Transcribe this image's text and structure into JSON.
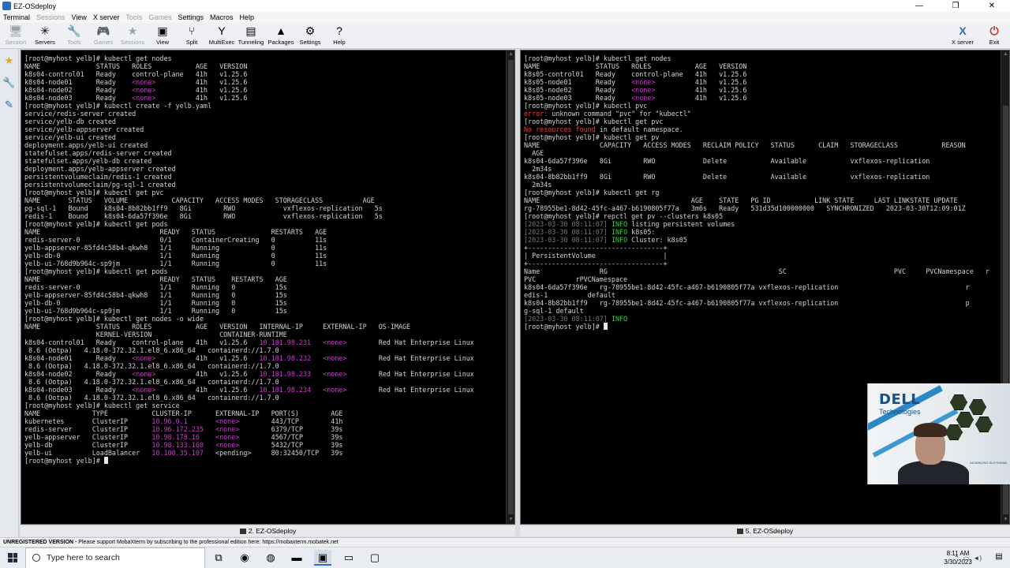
{
  "window": {
    "title": "EZ-OSdeploy",
    "controls": [
      "—",
      "❐",
      "✕"
    ]
  },
  "menu": [
    {
      "label": "Terminal",
      "enabled": true
    },
    {
      "label": "Sessions",
      "enabled": false
    },
    {
      "label": "View",
      "enabled": true
    },
    {
      "label": "X server",
      "enabled": true
    },
    {
      "label": "Tools",
      "enabled": false
    },
    {
      "label": "Games",
      "enabled": false
    },
    {
      "label": "Settings",
      "enabled": true
    },
    {
      "label": "Macros",
      "enabled": true
    },
    {
      "label": "Help",
      "enabled": true
    }
  ],
  "toolbar": {
    "items": [
      {
        "label": "Session",
        "icon": "session-icon",
        "glyph": "🖥",
        "enabled": false
      },
      {
        "label": "Servers",
        "icon": "servers-icon",
        "glyph": "✳",
        "enabled": true
      },
      {
        "label": "Tools",
        "icon": "tools-icon",
        "glyph": "🔧",
        "enabled": false
      },
      {
        "label": "Games",
        "icon": "games-icon",
        "glyph": "🎮",
        "enabled": false
      },
      {
        "label": "Sessions",
        "icon": "sessions-star-icon",
        "glyph": "★",
        "enabled": false
      },
      {
        "label": "View",
        "icon": "view-icon",
        "glyph": "▣",
        "enabled": true
      },
      {
        "label": "Split",
        "icon": "split-icon",
        "glyph": "⑂",
        "enabled": true
      },
      {
        "label": "MultiExec",
        "icon": "multiexec-icon",
        "glyph": "Y",
        "enabled": true
      },
      {
        "label": "Tunneling",
        "icon": "tunneling-icon",
        "glyph": "▤",
        "enabled": true
      },
      {
        "label": "Packages",
        "icon": "packages-icon",
        "glyph": "▲",
        "enabled": true
      },
      {
        "label": "Settings",
        "icon": "settings-gear-icon",
        "glyph": "⚙",
        "enabled": true
      },
      {
        "label": "Help",
        "icon": "help-icon",
        "glyph": "?",
        "enabled": true
      }
    ],
    "right": [
      {
        "label": "X server",
        "icon": "xserver-icon",
        "glyph": "X"
      },
      {
        "label": "Exit",
        "icon": "power-icon",
        "glyph": "⏻"
      }
    ]
  },
  "left_terminal": {
    "tab_label": "2. EZ-OSdeploy",
    "lines": [
      [
        {
          "t": "[root@myhost yelb]# kubectl get nodes"
        }
      ],
      [
        {
          "t": "NAME              STATUS   ROLES           AGE   VERSION"
        }
      ],
      [
        {
          "t": "k8s04-control01   Ready    control-plane   41h   v1.25.6"
        }
      ],
      [
        {
          "t": "k8s04-node01      Ready    "
        },
        {
          "t": "<none>",
          "c": "mag"
        },
        {
          "t": "          41h   v1.25.6"
        }
      ],
      [
        {
          "t": "k8s04-node02      Ready    "
        },
        {
          "t": "<none>",
          "c": "mag"
        },
        {
          "t": "          41h   v1.25.6"
        }
      ],
      [
        {
          "t": "k8s04-node03      Ready    "
        },
        {
          "t": "<none>",
          "c": "mag"
        },
        {
          "t": "          41h   v1.25.6"
        }
      ],
      [
        {
          "t": "[root@myhost yelb]# kubectl create -f yelb.yaml"
        }
      ],
      [
        {
          "t": "service/redis-server created"
        }
      ],
      [
        {
          "t": "service/yelb-db created"
        }
      ],
      [
        {
          "t": "service/yelb-appserver created"
        }
      ],
      [
        {
          "t": "service/yelb-ui created"
        }
      ],
      [
        {
          "t": "deployment.apps/yelb-ui created"
        }
      ],
      [
        {
          "t": "statefulset.apps/redis-server created"
        }
      ],
      [
        {
          "t": "statefulset.apps/yelb-db created"
        }
      ],
      [
        {
          "t": "deployment.apps/yelb-appserver created"
        }
      ],
      [
        {
          "t": "persistentvolumeclaim/redis-1 created"
        }
      ],
      [
        {
          "t": "persistentvolumeclaim/pg-sql-1 created"
        }
      ],
      [
        {
          "t": "[root@myhost yelb]# kubectl get pvc"
        }
      ],
      [
        {
          "t": "NAME       STATUS   VOLUME           CAPACITY   ACCESS MODES   STORAGECLASS          AGE"
        }
      ],
      [
        {
          "t": "pg-sql-1   Bound    k8s04-8b82bb1ff9   8Gi        RWO            vxflexos-replication   5s"
        }
      ],
      [
        {
          "t": "redis-1    Bound    k8s04-6da57f396e   8Gi        RWO            vxflexos-replication   5s"
        }
      ],
      [
        {
          "t": "[root@myhost yelb]# kubectl get pods"
        }
      ],
      [
        {
          "t": "NAME                              READY   STATUS              RESTARTS   AGE"
        }
      ],
      [
        {
          "t": "redis-server-0                    0/1     ContainerCreating   0          11s"
        }
      ],
      [
        {
          "t": "yelb-appserver-85fd4c58b4-qkwh8   1/1     Running             0          11s"
        }
      ],
      [
        {
          "t": "yelb-db-0                         1/1     Running             0          11s"
        }
      ],
      [
        {
          "t": "yelb-ui-768d9b964c-sp9jm          1/1     Running             0          11s"
        }
      ],
      [
        {
          "t": "[root@myhost yelb]# kubectl get pods"
        }
      ],
      [
        {
          "t": "NAME                              READY   STATUS    RESTARTS   AGE"
        }
      ],
      [
        {
          "t": "redis-server-0                    1/1     Running   0          15s"
        }
      ],
      [
        {
          "t": "yelb-appserver-85fd4c58b4-qkwh8   1/1     Running   0          15s"
        }
      ],
      [
        {
          "t": "yelb-db-0                         1/1     Running   0          15s"
        }
      ],
      [
        {
          "t": "yelb-ui-768d9b964c-sp9jm          1/1     Running   0          15s"
        }
      ],
      [
        {
          "t": "[root@myhost yelb]# kubectl get nodes -o wide"
        }
      ],
      [
        {
          "t": "NAME              STATUS   ROLES           AGE   VERSION   INTERNAL-IP     EXTERNAL-IP   OS-IMAGE"
        }
      ],
      [
        {
          "t": "                  KERNEL-VERSION                 CONTAINER-RUNTIME"
        }
      ],
      [
        {
          "t": "k8s04-control01   Ready    control-plane   41h   v1.25.6   "
        },
        {
          "t": "10.181.98.231",
          "c": "mag"
        },
        {
          "t": "   "
        },
        {
          "t": "<none>",
          "c": "mag"
        },
        {
          "t": "        Red Hat Enterprise Linux"
        }
      ],
      [
        {
          "t": " 8.6 (Ootpa)   4.18.0-372.32.1.el8_6.x86_64   containerd://1.7.0"
        }
      ],
      [
        {
          "t": "k8s04-node01      Ready    "
        },
        {
          "t": "<none>",
          "c": "mag"
        },
        {
          "t": "          41h   v1.25.6   "
        },
        {
          "t": "10.181.98.232",
          "c": "mag"
        },
        {
          "t": "   "
        },
        {
          "t": "<none>",
          "c": "mag"
        },
        {
          "t": "        Red Hat Enterprise Linux"
        }
      ],
      [
        {
          "t": " 8.6 (Ootpa)   4.18.0-372.32.1.el8_6.x86_64   containerd://1.7.0"
        }
      ],
      [
        {
          "t": "k8s04-node02      Ready    "
        },
        {
          "t": "<none>",
          "c": "mag"
        },
        {
          "t": "          41h   v1.25.6   "
        },
        {
          "t": "10.181.98.233",
          "c": "mag"
        },
        {
          "t": "   "
        },
        {
          "t": "<none>",
          "c": "mag"
        },
        {
          "t": "        Red Hat Enterprise Linux"
        }
      ],
      [
        {
          "t": " 8.6 (Ootpa)   4.18.0-372.32.1.el8_6.x86_64   containerd://1.7.0"
        }
      ],
      [
        {
          "t": "k8s04-node03      Ready    "
        },
        {
          "t": "<none>",
          "c": "mag"
        },
        {
          "t": "          41h   v1.25.6   "
        },
        {
          "t": "10.181.98.234",
          "c": "mag"
        },
        {
          "t": "   "
        },
        {
          "t": "<none>",
          "c": "mag"
        },
        {
          "t": "        Red Hat Enterprise Linux"
        }
      ],
      [
        {
          "t": " 8.6 (Ootpa)   4.18.0-372.32.1.el8_6.x86_64   containerd://1.7.0"
        }
      ],
      [
        {
          "t": "[root@myhost yelb]# kubectl get service"
        }
      ],
      [
        {
          "t": "NAME             TYPE           CLUSTER-IP      EXTERNAL-IP   PORT(S)        AGE"
        }
      ],
      [
        {
          "t": "kubernetes       ClusterIP      "
        },
        {
          "t": "10.96.0.1",
          "c": "mag"
        },
        {
          "t": "       "
        },
        {
          "t": "<none>",
          "c": "mag"
        },
        {
          "t": "        443/TCP        41h"
        }
      ],
      [
        {
          "t": "redis-server     ClusterIP      "
        },
        {
          "t": "10.96.172.235",
          "c": "mag"
        },
        {
          "t": "   "
        },
        {
          "t": "<none>",
          "c": "mag"
        },
        {
          "t": "        6379/TCP       39s"
        }
      ],
      [
        {
          "t": "yelb-appserver   ClusterIP      "
        },
        {
          "t": "10.98.178.16",
          "c": "mag"
        },
        {
          "t": "    "
        },
        {
          "t": "<none>",
          "c": "mag"
        },
        {
          "t": "        4567/TCP       39s"
        }
      ],
      [
        {
          "t": "yelb-db          ClusterIP      "
        },
        {
          "t": "10.98.133.160",
          "c": "mag"
        },
        {
          "t": "   "
        },
        {
          "t": "<none>",
          "c": "mag"
        },
        {
          "t": "        5432/TCP       39s"
        }
      ],
      [
        {
          "t": "yelb-ui          LoadBalancer   "
        },
        {
          "t": "10.100.35.107",
          "c": "mag"
        },
        {
          "t": "   <pending>     80:32450/TCP   39s"
        }
      ],
      [
        {
          "t": "[root@myhost yelb]# "
        },
        {
          "cursor": true
        }
      ]
    ]
  },
  "right_terminal": {
    "tab_label": "5. EZ-OSdeploy",
    "lines": [
      [
        {
          "t": "[root@myhost yelb]# kubectl get nodes"
        }
      ],
      [
        {
          "t": "NAME              STATUS   ROLES           AGE   VERSION"
        }
      ],
      [
        {
          "t": "k8s05-control01   Ready    control-plane   41h   v1.25.6"
        }
      ],
      [
        {
          "t": "k8s05-node01      Ready    "
        },
        {
          "t": "<none>",
          "c": "mag"
        },
        {
          "t": "          41h   v1.25.6"
        }
      ],
      [
        {
          "t": "k8s05-node02      Ready    "
        },
        {
          "t": "<none>",
          "c": "mag"
        },
        {
          "t": "          41h   v1.25.6"
        }
      ],
      [
        {
          "t": "k8s05-node03      Ready    "
        },
        {
          "t": "<none>",
          "c": "mag"
        },
        {
          "t": "          41h   v1.25.6"
        }
      ],
      [
        {
          "t": "[root@myhost yelb]# kubectl pvc"
        }
      ],
      [
        {
          "t": "error:",
          "c": "red"
        },
        {
          "t": " unknown command \"pvc\" for \"kubectl\""
        }
      ],
      [
        {
          "t": "[root@myhost yelb]# kubectl get pvc"
        }
      ],
      [
        {
          "t": "No resources found",
          "c": "red"
        },
        {
          "t": " in default namespace."
        }
      ],
      [
        {
          "t": "[root@myhost yelb]# kubectl get pv"
        }
      ],
      [
        {
          "t": "NAME               CAPACITY   ACCESS MODES   RECLAIM POLICY   STATUS      CLAIM   STORAGECLASS           REASON"
        }
      ],
      [
        {
          "t": "  AGE"
        }
      ],
      [
        {
          "t": "k8s04-6da57f396e   8Gi        RWO            Delete           Available           vxflexos-replication"
        }
      ],
      [
        {
          "t": "  2m34s"
        }
      ],
      [
        {
          "t": "k8s04-8b82bb1ff9   8Gi        RWO            Delete           Available           vxflexos-replication"
        }
      ],
      [
        {
          "t": "  2m34s"
        }
      ],
      [
        {
          "t": "[root@myhost yelb]# kubectl get rg"
        }
      ],
      [
        {
          "t": "NAME                                      AGE    STATE   PG ID           LINK STATE     LAST LINKSTATE UPDATE"
        }
      ],
      [
        {
          "t": "rg-78955be1-8d42-45fc-a467-b6190805f77a   3m6s   Ready   531d35d100000000   SYNCHRONIZED   2023-03-30T12:09:01Z"
        }
      ],
      [
        {
          "t": "[root@myhost yelb]# repctl get pv --clusters k8s05"
        }
      ],
      [
        {
          "t": "[2023-03-30 08:11:07]",
          "c": "gry"
        },
        {
          "t": " "
        },
        {
          "t": "INFO",
          "c": "grn"
        },
        {
          "t": " listing persistent volumes"
        }
      ],
      [
        {
          "t": "[2023-03-30 08:11:07]",
          "c": "gry"
        },
        {
          "t": " "
        },
        {
          "t": "INFO",
          "c": "grn"
        },
        {
          "t": " k8s05:"
        }
      ],
      [
        {
          "t": "[2023-03-30 08:11:07]",
          "c": "gry"
        },
        {
          "t": " "
        },
        {
          "t": "INFO",
          "c": "grn"
        },
        {
          "t": " Cluster: k8s05"
        }
      ],
      [
        {
          "t": "+----------------------------------+"
        }
      ],
      [
        {
          "t": "| PersistentVolume                 |"
        }
      ],
      [
        {
          "t": "+----------------------------------+"
        }
      ],
      [
        {
          "t": "Name               RG                                           SC                           PVC     PVCNamespace   r"
        }
      ],
      [
        {
          "t": "PVC          rPVCNamespace"
        }
      ],
      [
        {
          "t": "k8s04-6da57f396e   rg-78955be1-8d42-45fc-a467-b6190805f77a vxflexos-replication                                r"
        }
      ],
      [
        {
          "t": "edis-1          default"
        }
      ],
      [
        {
          "t": "k8s04-8b82bb1ff9   rg-78955be1-8d42-45fc-a467-b6190805f77a vxflexos-replication                                p"
        }
      ],
      [
        {
          "t": "g-sql-1 default"
        }
      ],
      [
        {
          "t": "[2023-03-30 08:11:07]",
          "c": "gry"
        },
        {
          "t": " "
        },
        {
          "t": "INFO",
          "c": "grn"
        }
      ],
      [
        {
          "t": "[root@myhost yelb]# "
        },
        {
          "cursor": true
        }
      ]
    ]
  },
  "left_strip": [
    {
      "icon": "favorites-star-icon",
      "glyph": "★",
      "color": "#e8a317"
    },
    {
      "icon": "tools-wrench-icon",
      "glyph": "🔧",
      "color": "#c0392b"
    },
    {
      "icon": "macros-pen-icon",
      "glyph": "✎",
      "color": "#2a6db8"
    }
  ],
  "statusbar": {
    "bold": "UNREGISTERED VERSION",
    "text": " -  Please support MobaXterm by subscribing to the professional edition here:  https://mobaxterm.mobatek.net"
  },
  "taskbar": {
    "search_placeholder": "Type here to search",
    "apps": [
      {
        "icon": "task-view-icon",
        "glyph": "⧉"
      },
      {
        "icon": "edge-icon",
        "glyph": "◉"
      },
      {
        "icon": "chrome-icon",
        "glyph": "◍"
      },
      {
        "icon": "file-explorer-icon",
        "glyph": "▬"
      },
      {
        "icon": "mobaxterm-icon",
        "glyph": "▣"
      },
      {
        "icon": "terminal-icon",
        "glyph": "▭"
      },
      {
        "icon": "remote-desktop-icon",
        "glyph": "▢"
      }
    ],
    "time": "8:11 AM",
    "date": "3/30/2023"
  },
  "webcam": {
    "brand": "DELL",
    "brand_sub": "Technologies",
    "tagline": "ADVANCING SUSTAINAB"
  },
  "colors": {
    "terminal_bg": "#000000",
    "terminal_fg": "#d4d4d4",
    "magenta": "#d33ad3",
    "error_red": "#e24040",
    "info_green": "#3fcf3f"
  }
}
